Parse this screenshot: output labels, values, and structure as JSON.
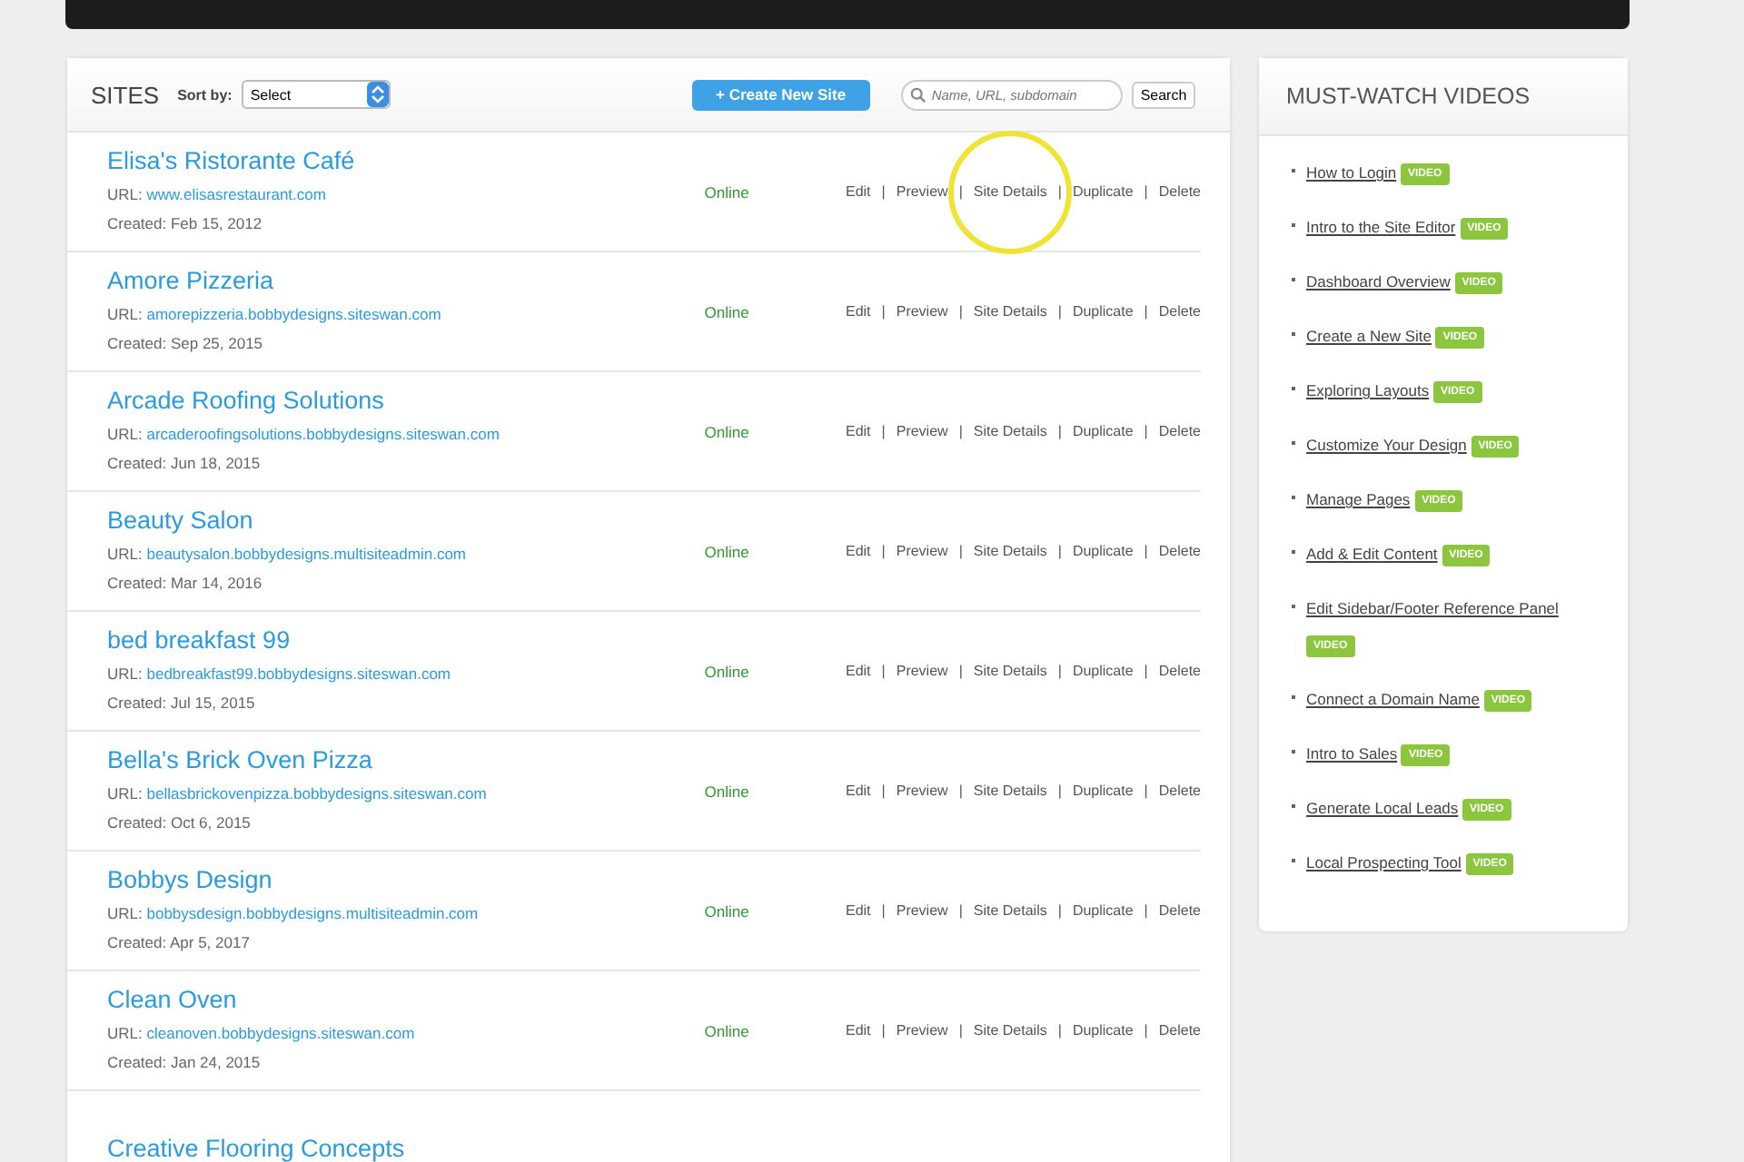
{
  "sites_panel": {
    "title": "SITES",
    "sort_label": "Sort by:",
    "sort_value": "Select",
    "create_button": "+ Create New Site",
    "search": {
      "placeholder": "Name, URL, subdomain",
      "button": "Search"
    },
    "rows": [
      {
        "name": "Elisa's Ristorante Café",
        "url_label": "URL:",
        "url": "www.elisasrestaurant.com",
        "created": "Created: Feb 15, 2012",
        "status": "Online",
        "highlighted": true,
        "actions": [
          "Edit",
          "|",
          "Preview",
          "|",
          "Site Details",
          "|",
          "Duplicate",
          "|",
          "Delete"
        ]
      },
      {
        "name": "Amore Pizzeria",
        "url_label": "URL:",
        "url": "amorepizzeria.bobbydesigns.siteswan.com",
        "created": "Created: Sep 25, 2015",
        "status": "Online",
        "highlighted": false,
        "actions": [
          "Edit",
          "|",
          "Preview",
          "|",
          "Site Details",
          "|",
          "Duplicate",
          "|",
          "Delete"
        ]
      },
      {
        "name": "Arcade Roofing Solutions",
        "url_label": "URL:",
        "url": "arcaderoofingsolutions.bobbydesigns.siteswan.com",
        "created": "Created: Jun 18, 2015",
        "status": "Online",
        "highlighted": false,
        "actions": [
          "Edit",
          "|",
          "Preview",
          "|",
          "Site Details",
          "|",
          "Duplicate",
          "|",
          "Delete"
        ]
      },
      {
        "name": "Beauty Salon",
        "url_label": "URL:",
        "url": "beautysalon.bobbydesigns.multisiteadmin.com",
        "created": "Created: Mar 14, 2016",
        "status": "Online",
        "highlighted": false,
        "actions": [
          "Edit",
          "|",
          "Preview",
          "|",
          "Site Details",
          "|",
          "Duplicate",
          "|",
          "Delete"
        ]
      },
      {
        "name": "bed breakfast 99",
        "url_label": "URL:",
        "url": "bedbreakfast99.bobbydesigns.siteswan.com",
        "created": "Created: Jul 15, 2015",
        "status": "Online",
        "highlighted": false,
        "actions": [
          "Edit",
          "|",
          "Preview",
          "|",
          "Site Details",
          "|",
          "Duplicate",
          "|",
          "Delete"
        ]
      },
      {
        "name": "Bella's Brick Oven Pizza",
        "url_label": "URL:",
        "url": "bellasbrickovenpizza.bobbydesigns.siteswan.com",
        "created": "Created: Oct 6, 2015",
        "status": "Online",
        "highlighted": false,
        "actions": [
          "Edit",
          "|",
          "Preview",
          "|",
          "Site Details",
          "|",
          "Duplicate",
          "|",
          "Delete"
        ]
      },
      {
        "name": "Bobbys Design",
        "url_label": "URL:",
        "url": "bobbysdesign.bobbydesigns.multisiteadmin.com",
        "created": "Created: Apr 5, 2017",
        "status": "Online",
        "highlighted": false,
        "actions": [
          "Edit",
          "|",
          "Preview",
          "|",
          "Site Details",
          "|",
          "Duplicate",
          "|",
          "Delete"
        ]
      },
      {
        "name": "Clean Oven",
        "url_label": "URL:",
        "url": "cleanoven.bobbydesigns.siteswan.com",
        "created": "Created: Jan 24, 2015",
        "status": "Online",
        "highlighted": false,
        "actions": [
          "Edit",
          "|",
          "Preview",
          "|",
          "Site Details",
          "|",
          "Duplicate",
          "|",
          "Delete"
        ]
      },
      {
        "name": "Creative Flooring Concepts",
        "highlighted": false
      }
    ]
  },
  "videos_panel": {
    "title": "MUST-WATCH VIDEOS",
    "items": [
      {
        "label": "How to Login",
        "badge": "VIDEO"
      },
      {
        "label": "Intro to the Site Editor",
        "badge": "VIDEO"
      },
      {
        "label": "Dashboard Overview",
        "badge": "VIDEO"
      },
      {
        "label": "Create a New Site",
        "badge": "VIDEO"
      },
      {
        "label": "Exploring Layouts",
        "badge": "VIDEO"
      },
      {
        "label": "Customize Your Design",
        "badge": "VIDEO"
      },
      {
        "label": "Manage Pages",
        "badge": "VIDEO"
      },
      {
        "label": "Add & Edit Content",
        "badge": "VIDEO"
      },
      {
        "label": "Edit Sidebar/Footer Reference Panel",
        "badge": "VIDEO"
      },
      {
        "label": "Connect a Domain Name",
        "badge": "VIDEO"
      },
      {
        "label": "Intro to Sales",
        "badge": "VIDEO"
      },
      {
        "label": "Generate Local Leads",
        "badge": "VIDEO"
      },
      {
        "label": "Local Prospecting Tool",
        "badge": "VIDEO"
      }
    ]
  }
}
